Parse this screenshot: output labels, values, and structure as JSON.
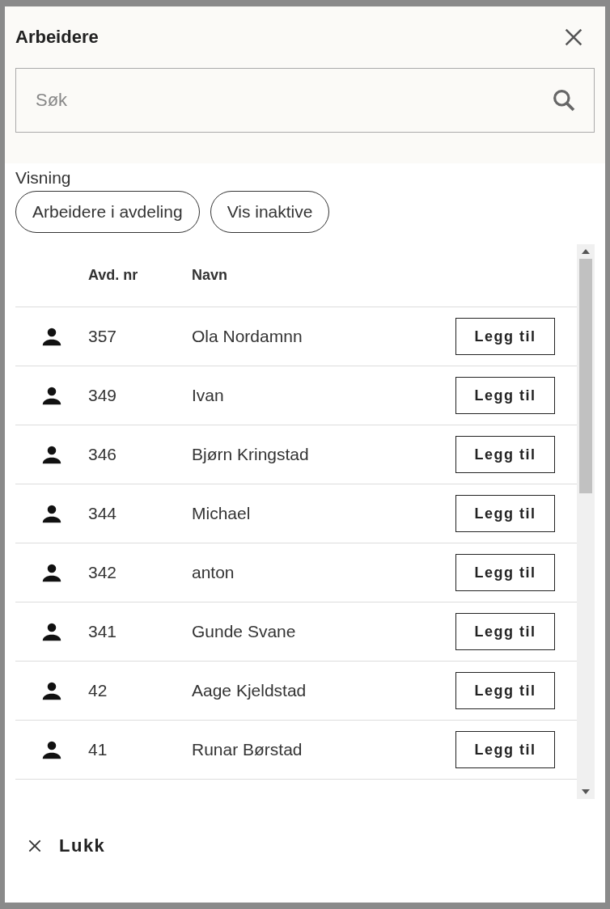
{
  "dialog": {
    "title": "Arbeidere"
  },
  "search": {
    "placeholder": "Søk"
  },
  "view": {
    "label": "Visning",
    "chips": [
      {
        "label": "Arbeidere i avdeling",
        "selected": false
      },
      {
        "label": "Vis inaktive",
        "selected": false
      }
    ]
  },
  "table": {
    "columns": [
      "Avd. nr",
      "Navn"
    ],
    "rows": [
      {
        "number": "357",
        "name": "Ola Nordamnn",
        "action": "Legg til"
      },
      {
        "number": "349",
        "name": "Ivan",
        "action": "Legg til"
      },
      {
        "number": "346",
        "name": "Bjørn Kringstad",
        "action": "Legg til"
      },
      {
        "number": "344",
        "name": "Michael",
        "action": "Legg til"
      },
      {
        "number": "342",
        "name": "anton",
        "action": "Legg til"
      },
      {
        "number": "341",
        "name": "Gunde Svane",
        "action": "Legg til"
      },
      {
        "number": "42",
        "name": "Aage Kjeldstad",
        "action": "Legg til"
      },
      {
        "number": "41",
        "name": "Runar Børstad",
        "action": "Legg til"
      }
    ]
  },
  "footer": {
    "close_button": "Lukk"
  }
}
